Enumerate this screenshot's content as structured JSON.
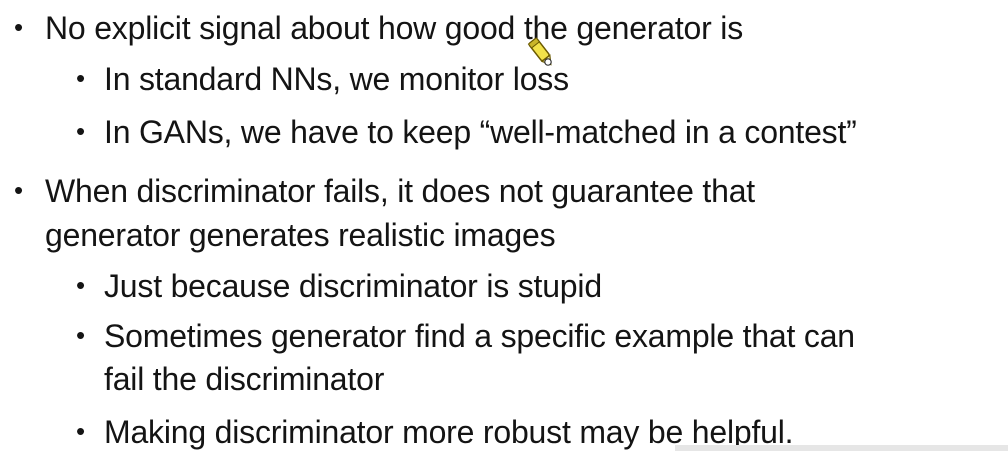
{
  "slide": {
    "bullets": [
      {
        "text": "No explicit signal about how good the generator is",
        "sub": [
          "In standard NNs, we monitor loss",
          "In GANs, we have to keep “well-matched in a contest”"
        ]
      },
      {
        "text_line1": "When discriminator fails, it does not guarantee that",
        "text_line2": "generator generates realistic images",
        "sub": [
          {
            "line1": "Just because discriminator is stupid"
          },
          {
            "line1": "Sometimes generator find a specific example that can",
            "line2": "fail the discriminator"
          },
          {
            "line1": "Making discriminator more robust may be helpful."
          }
        ]
      }
    ],
    "bullet_glyph": "•",
    "cursor_icon": "pen-cursor-icon",
    "colors": {
      "text": "#141414",
      "background": "#ffffff",
      "cursor_fill": "#f2e24a"
    }
  }
}
